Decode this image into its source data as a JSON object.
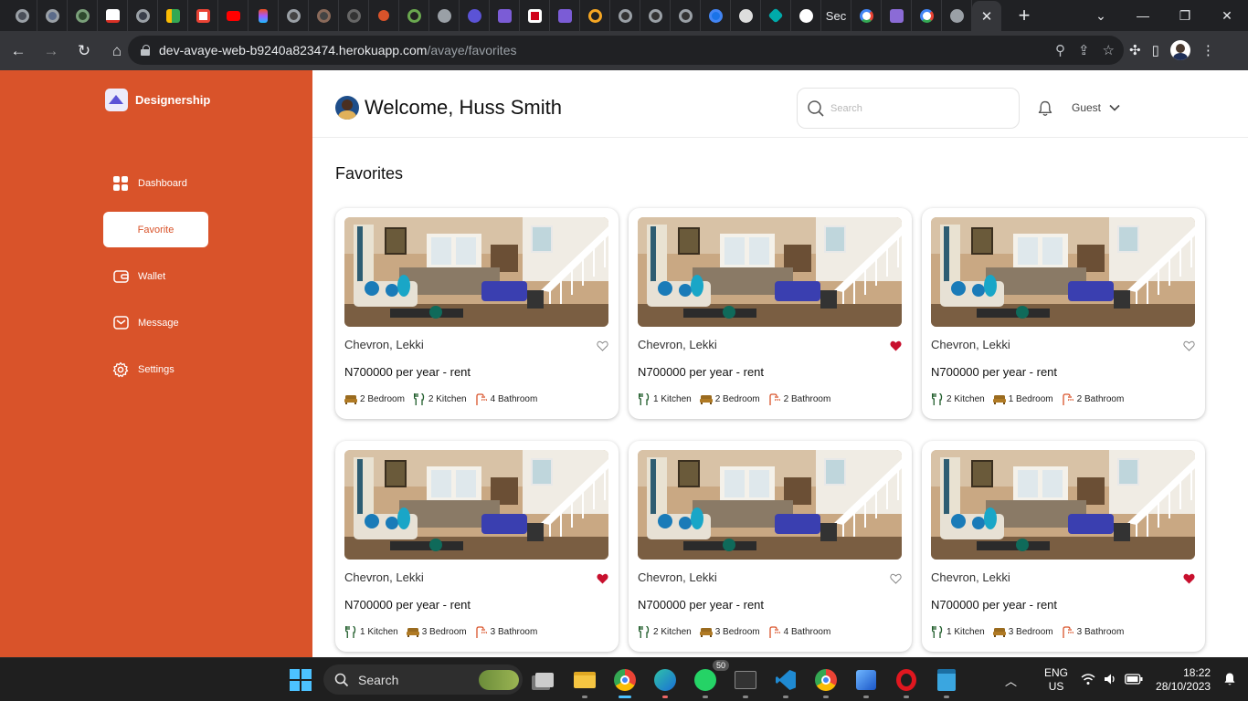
{
  "browser": {
    "active_tab_close": "✕",
    "partial_tab_title": "Sec",
    "url_host": "dev-avaye-web-b9240a823474.herokuapp.com",
    "url_path": "/avaye/favorites"
  },
  "app": {
    "brand": "Designership",
    "menu": [
      "Dashboard",
      "Favorite",
      "Wallet",
      "Message",
      "Settings"
    ],
    "active_menu": "Favorite",
    "welcome": "Welcome, Huss Smith",
    "search_placeholder": "Search",
    "user_role": "Guest",
    "page_title": "Favorites",
    "colors": {
      "accent": "#d9532a",
      "heart_filled": "#c8102e"
    }
  },
  "cards": [
    {
      "location": "Chevron, Lekki",
      "price": "N700000 per year - rent",
      "favorited": false,
      "features": [
        {
          "icon": "bed-icon",
          "label": "2 Bedroom"
        },
        {
          "icon": "kitchen-icon",
          "label": "2 Kitchen"
        },
        {
          "icon": "bathroom-icon",
          "label": "4 Bathroom"
        }
      ]
    },
    {
      "location": "Chevron, Lekki",
      "price": "N700000 per year - rent",
      "favorited": true,
      "features": [
        {
          "icon": "kitchen-icon",
          "label": "1 Kitchen"
        },
        {
          "icon": "bed-icon",
          "label": "2 Bedroom"
        },
        {
          "icon": "bathroom-icon",
          "label": "2 Bathroom"
        }
      ]
    },
    {
      "location": "Chevron, Lekki",
      "price": "N700000 per year - rent",
      "favorited": false,
      "features": [
        {
          "icon": "kitchen-icon",
          "label": "2 Kitchen"
        },
        {
          "icon": "bed-icon",
          "label": "1 Bedroom"
        },
        {
          "icon": "bathroom-icon",
          "label": "2 Bathroom"
        }
      ]
    },
    {
      "location": "Chevron, Lekki",
      "price": "N700000 per year - rent",
      "favorited": true,
      "features": [
        {
          "icon": "kitchen-icon",
          "label": "1 Kitchen"
        },
        {
          "icon": "bed-icon",
          "label": "3 Bedroom"
        },
        {
          "icon": "bathroom-icon",
          "label": "3 Bathroom"
        }
      ]
    },
    {
      "location": "Chevron, Lekki",
      "price": "N700000 per year - rent",
      "favorited": false,
      "features": [
        {
          "icon": "kitchen-icon",
          "label": "2 Kitchen"
        },
        {
          "icon": "bed-icon",
          "label": "3 Bedroom"
        },
        {
          "icon": "bathroom-icon",
          "label": "4 Bathroom"
        }
      ]
    },
    {
      "location": "Chevron, Lekki",
      "price": "N700000 per year - rent",
      "favorited": true,
      "features": [
        {
          "icon": "kitchen-icon",
          "label": "1 Kitchen"
        },
        {
          "icon": "bed-icon",
          "label": "3 Bedroom"
        },
        {
          "icon": "bathroom-icon",
          "label": "3 Bathroom"
        }
      ]
    }
  ],
  "taskbar": {
    "search_label": "Search",
    "whatsapp_badge": "50",
    "lang_line1": "ENG",
    "lang_line2": "US",
    "time": "18:22",
    "date": "28/10/2023"
  }
}
